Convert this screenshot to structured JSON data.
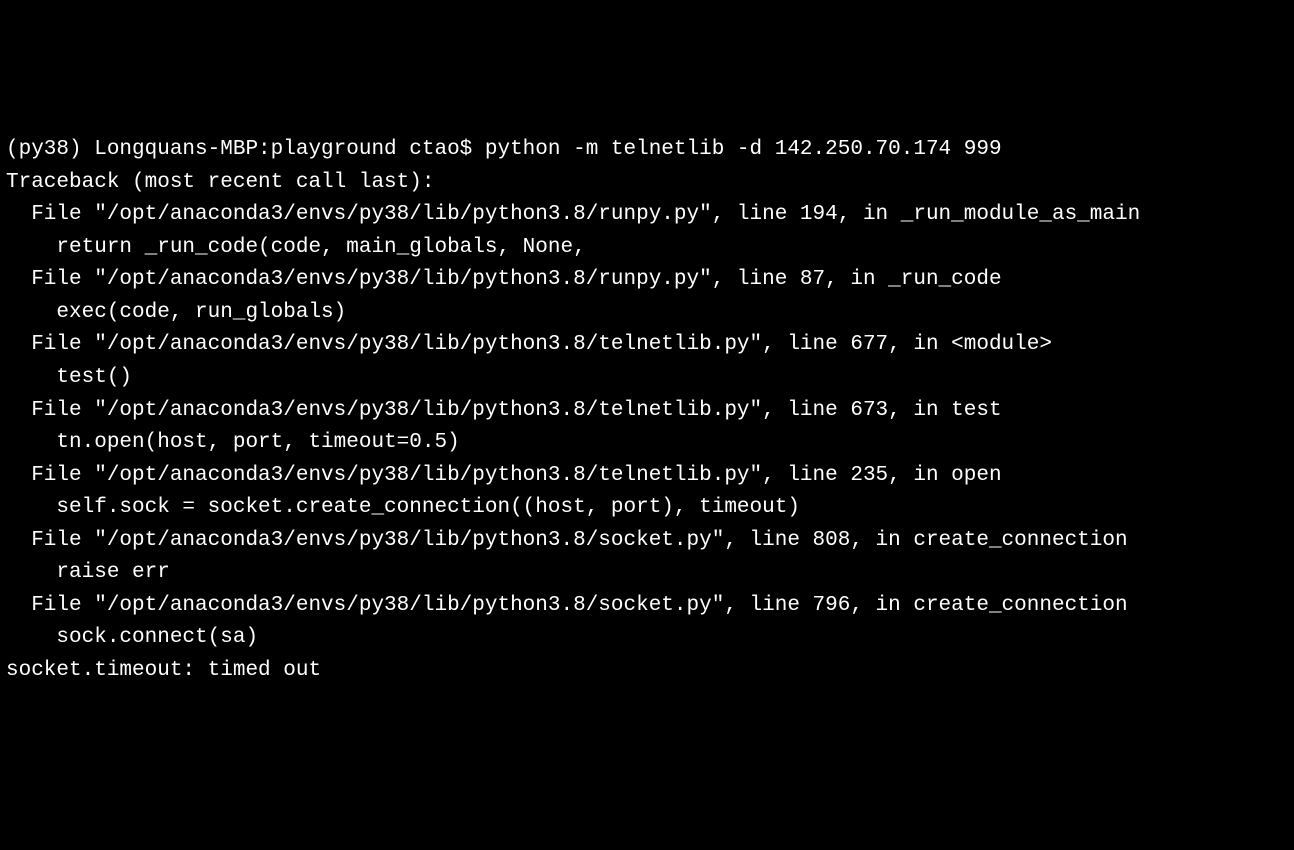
{
  "terminal": {
    "prompt_line": "(py38) Longquans-MBP:playground ctao$ python -m telnetlib -d 142.250.70.174 999",
    "traceback_header": "Traceback (most recent call last):",
    "frames": [
      {
        "file_line": "  File \"/opt/anaconda3/envs/py38/lib/python3.8/runpy.py\", line 194, in _run_module_as_main",
        "code_line": "    return _run_code(code, main_globals, None,"
      },
      {
        "file_line": "  File \"/opt/anaconda3/envs/py38/lib/python3.8/runpy.py\", line 87, in _run_code",
        "code_line": "    exec(code, run_globals)"
      },
      {
        "file_line": "  File \"/opt/anaconda3/envs/py38/lib/python3.8/telnetlib.py\", line 677, in <module>",
        "code_line": "    test()"
      },
      {
        "file_line": "  File \"/opt/anaconda3/envs/py38/lib/python3.8/telnetlib.py\", line 673, in test",
        "code_line": "    tn.open(host, port, timeout=0.5)"
      },
      {
        "file_line": "  File \"/opt/anaconda3/envs/py38/lib/python3.8/telnetlib.py\", line 235, in open",
        "code_line": "    self.sock = socket.create_connection((host, port), timeout)"
      },
      {
        "file_line": "  File \"/opt/anaconda3/envs/py38/lib/python3.8/socket.py\", line 808, in create_connection",
        "code_line": "    raise err"
      },
      {
        "file_line": "  File \"/opt/anaconda3/envs/py38/lib/python3.8/socket.py\", line 796, in create_connection",
        "code_line": "    sock.connect(sa)"
      }
    ],
    "error_line": "socket.timeout: timed out"
  }
}
